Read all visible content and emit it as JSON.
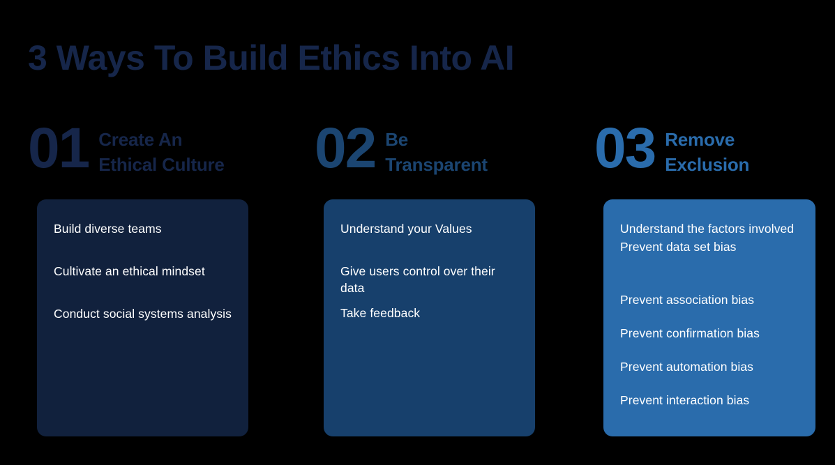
{
  "page": {
    "title": "3 Ways To Build Ethics Into AI",
    "background_color": "#000000",
    "title_color": "#16264a"
  },
  "columns": [
    {
      "number": "01",
      "heading": "Create An\nEthical Culture",
      "accent_color": "#16264a",
      "card_color": "#11213d",
      "items": [
        "Build diverse teams",
        "Cultivate an ethical mindset",
        "Conduct social systems analysis"
      ]
    },
    {
      "number": "02",
      "heading": "Be\nTransparent",
      "accent_color": "#1b4571",
      "card_color": "#17406c",
      "items": [
        "Understand your Values",
        "Give users control over their data",
        "Take feedback"
      ]
    },
    {
      "number": "03",
      "heading": "Remove\nExclusion",
      "accent_color": "#2a6cac",
      "card_color": "#2a6cac",
      "items": [
        "Understand the factors involved",
        "Prevent data set bias",
        "Prevent association bias",
        "Prevent confirmation bias",
        "Prevent automation bias",
        "Prevent interaction bias"
      ]
    }
  ]
}
